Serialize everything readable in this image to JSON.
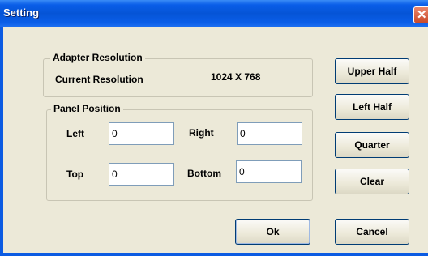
{
  "window": {
    "title": "Setting"
  },
  "adapter_group": {
    "legend": "Adapter Resolution",
    "current_label": "Current Resolution",
    "current_value": "1024 X 768"
  },
  "panel_group": {
    "legend": "Panel Position",
    "left_label": "Left",
    "right_label": "Right",
    "top_label": "Top",
    "bottom_label": "Bottom",
    "left_value": "0",
    "right_value": "0",
    "top_value": "0",
    "bottom_value": "0"
  },
  "side_buttons": {
    "upper_half": "Upper Half",
    "left_half": "Left Half",
    "quarter": "Quarter",
    "clear": "Clear"
  },
  "footer_buttons": {
    "ok": "Ok",
    "cancel": "Cancel"
  }
}
